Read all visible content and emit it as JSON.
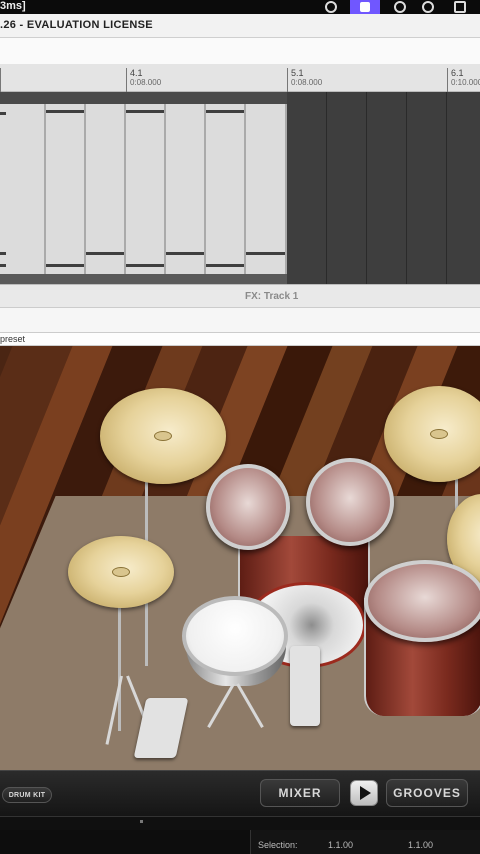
{
  "os_bar": {
    "clock": "3ms]",
    "tray_icons": [
      "chrome-icon",
      "screen-recorder-icon",
      "firefox-icon",
      "app-icon",
      "warning-icon"
    ]
  },
  "window": {
    "title": ".26 - EVALUATION LICENSE"
  },
  "ruler": {
    "marks": [
      {
        "bar": "",
        "time": ""
      },
      {
        "bar": "4.1",
        "time": "0:08.000"
      },
      {
        "bar": "5.1",
        "time": "0:08.000"
      },
      {
        "bar": "6.1",
        "time": "0:10.000"
      }
    ]
  },
  "fx_bar": {
    "label": "FX: Track 1"
  },
  "preset_bar": {
    "label": "preset"
  },
  "drum_panel": {
    "kit_button": "DRUM KIT",
    "mixer_button": "MIXER",
    "grooves_button": "GROOVES",
    "play_icon": "play-icon"
  },
  "status": {
    "selection_label": "Selection:",
    "selection_start": "1.1.00",
    "selection_end": "1.1.00"
  },
  "colors": {
    "accent": "#7057ff",
    "track_bg": "#5a5a5a",
    "clip": "#dcdcdc"
  }
}
